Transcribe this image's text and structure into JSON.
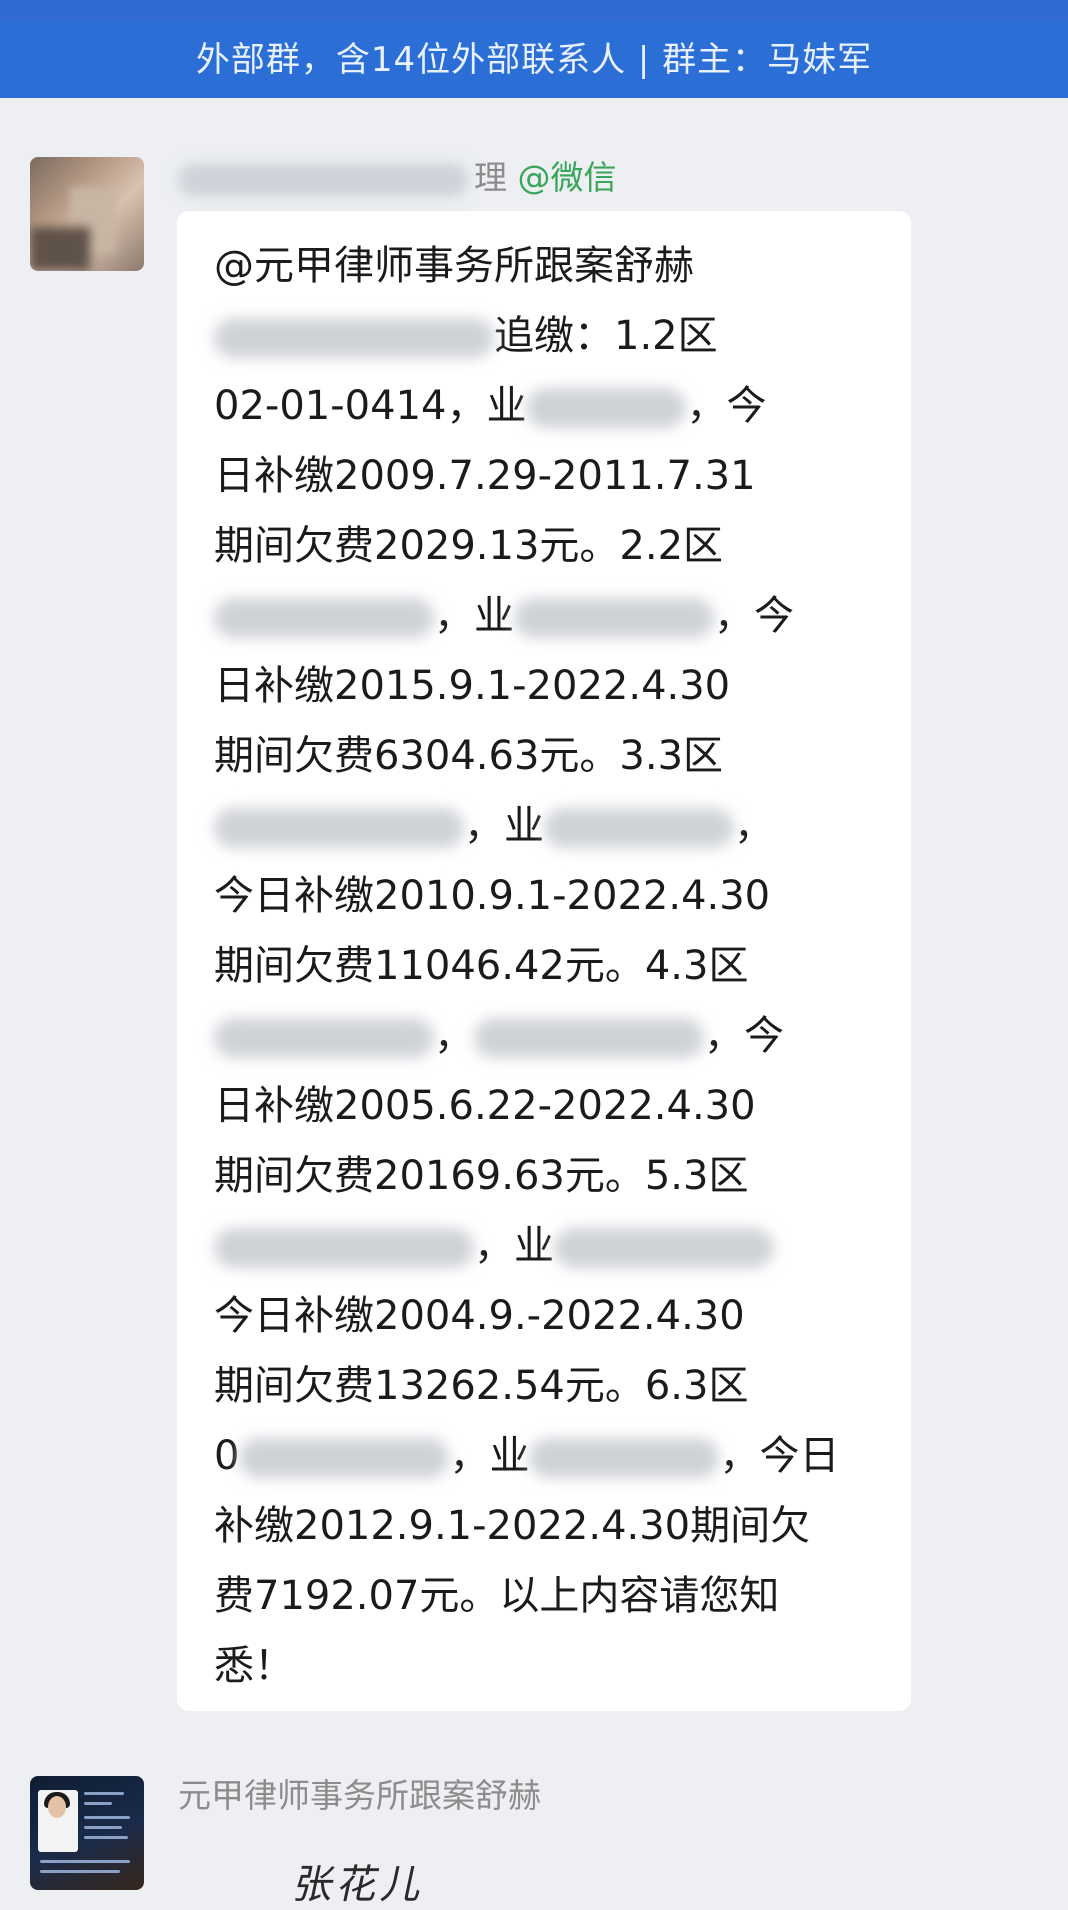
{
  "header": {
    "group_info": "外部群，含14位外部联系人 | 群主：马妹军"
  },
  "messages": [
    {
      "sender_suffix": "理",
      "sender_tag": "@微信",
      "lines": [
        {
          "text": "@元甲律师事务所跟案舒赫"
        },
        {
          "pre": "",
          "blur": 280,
          "post": "追缴：1.2区"
        },
        {
          "pre": "02-01-0414，业",
          "blur": 160,
          "post": "，今"
        },
        {
          "text": "日补缴2009.7.29-2011.7.31"
        },
        {
          "text": "期间欠费2029.13元。2.2区"
        },
        {
          "pre": "",
          "blur": 220,
          "post": "，业",
          "blur2": 200,
          "post2": "，今"
        },
        {
          "text": "日补缴2015.9.1-2022.4.30"
        },
        {
          "text": "期间欠费6304.63元。3.3区"
        },
        {
          "pre": "",
          "blur": 250,
          "post": "，业",
          "blur2": 190,
          "post2": "，"
        },
        {
          "text": "今日补缴2010.9.1-2022.4.30"
        },
        {
          "text": "期间欠费11046.42元。4.3区"
        },
        {
          "pre": "",
          "blur": 220,
          "post": "，",
          "blur2": 230,
          "post2": "，今"
        },
        {
          "text": "日补缴2005.6.22-2022.4.30"
        },
        {
          "text": "期间欠费20169.63元。5.3区"
        },
        {
          "pre": "",
          "blur": 260,
          "post": "，业",
          "blur2": 220,
          "post2": ""
        },
        {
          "text": "今日补缴2004.9.-2022.4.30"
        },
        {
          "text": "期间欠费13262.54元。6.3区"
        },
        {
          "pre": "0",
          "blur": 210,
          "post": "，业",
          "blur2": 190,
          "post2": "，今日"
        },
        {
          "text": "补缴2012.9.1-2022.4.30期间欠"
        },
        {
          "text": "费7192.07元。以上内容请您知"
        },
        {
          "text": "悉！"
        }
      ]
    },
    {
      "sender_name": "元甲律师事务所跟案舒赫",
      "signature": "张花儿"
    }
  ]
}
